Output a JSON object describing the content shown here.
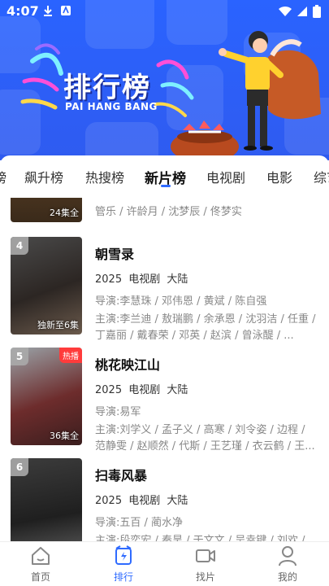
{
  "status": {
    "time": "4:07"
  },
  "banner": {
    "title": "排行榜",
    "subtitle": "PAI HANG BANG"
  },
  "tabs": [
    {
      "label": "榜",
      "active": false
    },
    {
      "label": "飙升榜",
      "active": false
    },
    {
      "label": "热搜榜",
      "active": false
    },
    {
      "label": "新片榜",
      "active": true
    },
    {
      "label": "电视剧",
      "active": false
    },
    {
      "label": "电影",
      "active": false
    },
    {
      "label": "综艺",
      "active": false
    }
  ],
  "items": [
    {
      "rank": "",
      "episodes": "24集全",
      "credit_line": "管乐 / 许龄月 / 沈梦辰 / 佟梦实"
    },
    {
      "rank": "4",
      "title": "朝雪录",
      "year": "2025",
      "type": "电视剧",
      "region": "大陆",
      "poster_text": "独新至6集",
      "director_label": "导演:",
      "director": "李慧珠 / 邓伟恩 / 黄斌 / 陈自强",
      "cast_label": "主演:",
      "cast": "李兰迪 / 敖瑞鹏 / 余承恩 / 沈羽洁 / 任重 / 丁嘉丽 / 戴春荣 / 邓英 / 赵滨 / 曾泳醍 / ..."
    },
    {
      "rank": "5",
      "title": "桃花映江山",
      "year": "2025",
      "type": "电视剧",
      "region": "大陆",
      "badge": "热播",
      "poster_text": "36集全",
      "director_label": "导演:",
      "director": "易军",
      "cast_label": "主演:",
      "cast": "刘学义 / 孟子义 / 高寒 / 刘令姿 / 边程 / 范静雯 / 赵顺然 / 代斯 / 王艺瑾 / 衣云鹤 / 王..."
    },
    {
      "rank": "6",
      "title": "扫毒风暴",
      "year": "2025",
      "type": "电视剧",
      "region": "大陆",
      "director_label": "导演:",
      "director": "五百 / 蔺水净",
      "cast_label": "主演:",
      "cast": "段奕宏 / 秦昊 / 于文文 / 吴幸键 / 刘欢 /"
    }
  ],
  "nav": [
    {
      "label": "首页",
      "icon": "home-icon",
      "active": false
    },
    {
      "label": "排行",
      "icon": "ranking-icon",
      "active": true
    },
    {
      "label": "找片",
      "icon": "video-camera-icon",
      "active": false
    },
    {
      "label": "我的",
      "icon": "user-icon",
      "active": false
    }
  ],
  "colors": {
    "accent": "#2f6bff",
    "banner": "#2a63ff",
    "hot_badge": "#ff3b3b"
  }
}
